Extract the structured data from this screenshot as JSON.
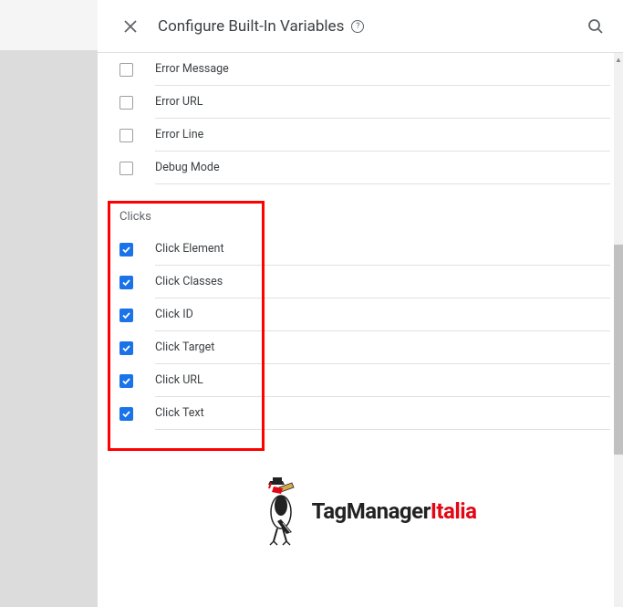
{
  "header": {
    "title": "Configure Built-In Variables"
  },
  "sections": [
    {
      "items": [
        {
          "label": "Error Message",
          "checked": false
        },
        {
          "label": "Error URL",
          "checked": false
        },
        {
          "label": "Error Line",
          "checked": false
        },
        {
          "label": "Debug Mode",
          "checked": false
        }
      ]
    },
    {
      "title": "Clicks",
      "items": [
        {
          "label": "Click Element",
          "checked": true
        },
        {
          "label": "Click Classes",
          "checked": true
        },
        {
          "label": "Click ID",
          "checked": true
        },
        {
          "label": "Click Target",
          "checked": true
        },
        {
          "label": "Click URL",
          "checked": true
        },
        {
          "label": "Click Text",
          "checked": true
        }
      ]
    }
  ],
  "logo": {
    "text1": "TagManager",
    "text2": "Italia"
  }
}
